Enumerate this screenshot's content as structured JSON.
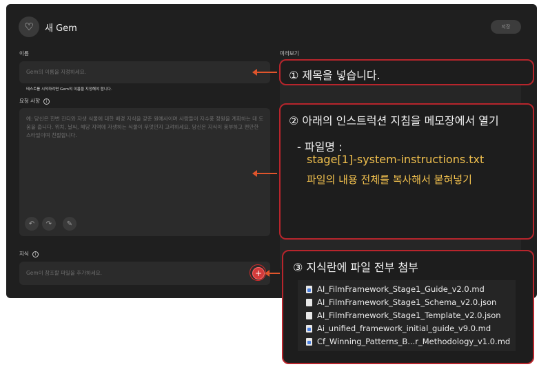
{
  "header": {
    "gem_icon": "gem-sparkle-icon",
    "title": "새 Gem",
    "save_label": "저장"
  },
  "form": {
    "name_label": "이름",
    "name_placeholder": "Gem의 이름을 지정하세요.",
    "name_hint": "테스트를 시작하려면 Gem의 이름을 지정해야 합니다.",
    "instructions_label": "요청 사항",
    "instructions_placeholder": "예: 당신은 한번 잔디와 자생 식물에 대한 배경 지식을 갖춘 원예사이며 사람들이 자수풍 정원을 계획하는 데 도움을 줍니다. 위치, 날씨, 해당 지역에 자생하는 식물이 무엇인지 고려하세요. 당신은 지식이 풍부하고 편안한 스타일이며 친절합니다.",
    "undo_icon": "undo-icon",
    "redo_icon": "redo-icon",
    "magic_icon": "magic-wand-icon",
    "knowledge_label": "지식",
    "knowledge_placeholder": "Gem이 참조할 파일을 추가하세요.",
    "add_symbol": "+"
  },
  "preview": {
    "label": "미리보기"
  },
  "callouts": {
    "step1": "① 제목을 넣습니다.",
    "step2": "② 아래의 인스트럭션 지침을 메모장에서 열기",
    "step2_file_label": "- 파일명 :",
    "step2_filename": "stage[1]-system-instructions.txt",
    "step2_action": "파일의 내용 전체를 복사해서 붙혀넣기",
    "step3": "③ 지식란에 파일 전부 첨부"
  },
  "files": [
    {
      "name": "AI_FilmFramework_Stage1_Guide_v2.0.md",
      "icon": "markdown-file-icon"
    },
    {
      "name": "AI_FilmFramework_Stage1_Schema_v2.0.json",
      "icon": "json-file-icon"
    },
    {
      "name": "AI_FilmFramework_Stage1_Template_v2.0.json",
      "icon": "json-file-icon"
    },
    {
      "name": "Ai_unified_framework_initial_guide_v9.0.md",
      "icon": "markdown-file-icon"
    },
    {
      "name": "Cf_Winning_Patterns_B...r_Methodology_v1.0.md",
      "icon": "markdown-file-icon"
    }
  ],
  "colors": {
    "accent_red": "#b8252c",
    "arrow_orange": "#e0552c",
    "highlight_yellow": "#f2c14e"
  }
}
